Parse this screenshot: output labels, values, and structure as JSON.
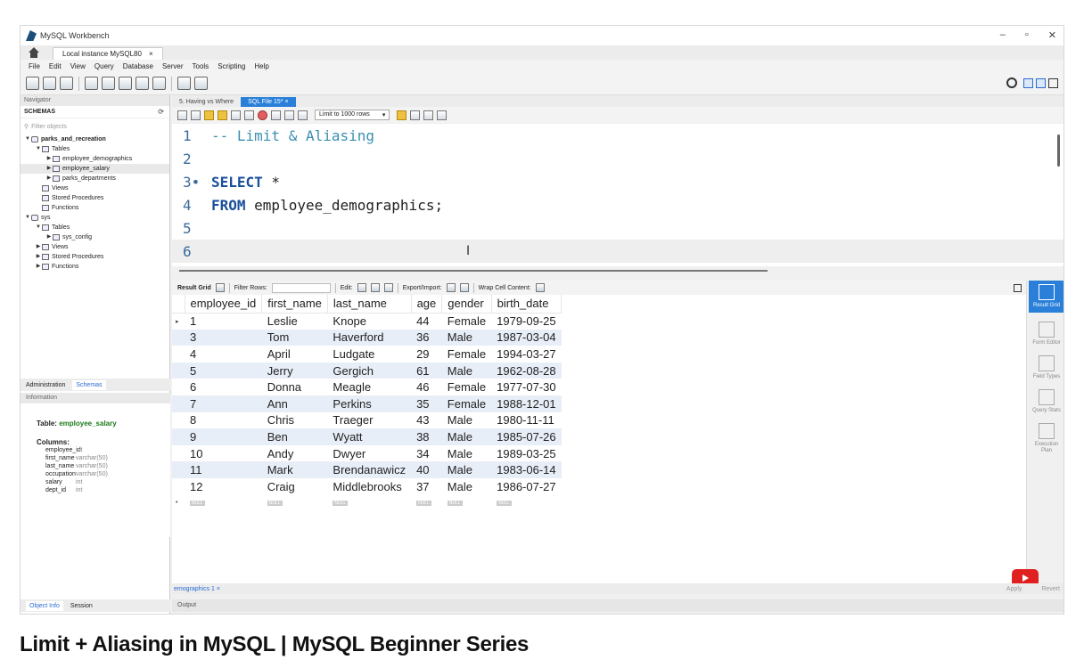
{
  "window": {
    "title": "MySQL Workbench",
    "connection_tab": "Local instance MySQL80",
    "close_glyph": "×"
  },
  "menu": [
    "File",
    "Edit",
    "View",
    "Query",
    "Database",
    "Server",
    "Tools",
    "Scripting",
    "Help"
  ],
  "navigator": {
    "header": "Navigator",
    "schemas_label": "SCHEMAS",
    "filter_placeholder": "Filter objects",
    "tree": [
      {
        "label": "parks_and_recreation",
        "level": 0,
        "arrow": "▼",
        "bold": true,
        "icon": "db"
      },
      {
        "label": "Tables",
        "level": 1,
        "arrow": "▼",
        "icon": "folder"
      },
      {
        "label": "employee_demographics",
        "level": 2,
        "arrow": "▶",
        "icon": "table"
      },
      {
        "label": "employee_salary",
        "level": 2,
        "arrow": "▶",
        "icon": "table",
        "selected": true
      },
      {
        "label": "parks_departments",
        "level": 2,
        "arrow": "▶",
        "icon": "table"
      },
      {
        "label": "Views",
        "level": 1,
        "arrow": "",
        "icon": "folder"
      },
      {
        "label": "Stored Procedures",
        "level": 1,
        "arrow": "",
        "icon": "folder"
      },
      {
        "label": "Functions",
        "level": 1,
        "arrow": "",
        "icon": "folder"
      },
      {
        "label": "sys",
        "level": 0,
        "arrow": "▼",
        "icon": "db"
      },
      {
        "label": "Tables",
        "level": 1,
        "arrow": "▼",
        "icon": "folder"
      },
      {
        "label": "sys_config",
        "level": 2,
        "arrow": "▶",
        "icon": "table"
      },
      {
        "label": "Views",
        "level": 1,
        "arrow": "▶",
        "icon": "folder"
      },
      {
        "label": "Stored Procedures",
        "level": 1,
        "arrow": "▶",
        "icon": "folder"
      },
      {
        "label": "Functions",
        "level": 1,
        "arrow": "▶",
        "icon": "folder"
      }
    ],
    "tabs": {
      "admin": "Administration",
      "schemas": "Schemas"
    }
  },
  "info": {
    "header": "Information",
    "table_prefix": "Table:",
    "table_name": "employee_salary",
    "columns_label": "Columns:",
    "columns": [
      {
        "name": "employee_id",
        "type": "int"
      },
      {
        "name": "first_name",
        "type": "varchar(50)"
      },
      {
        "name": "last_name",
        "type": "varchar(50)"
      },
      {
        "name": "occupation",
        "type": "varchar(50)"
      },
      {
        "name": "salary",
        "type": "int"
      },
      {
        "name": "dept_id",
        "type": "int"
      }
    ],
    "bottom_tabs": {
      "object_info": "Object Info",
      "session": "Session"
    }
  },
  "editor": {
    "tabs": [
      {
        "label": "5. Having vs Where",
        "active": false
      },
      {
        "label": "SQL File 15*",
        "active": true
      }
    ],
    "limit_label": "Limit to 1000 rows",
    "lines": [
      {
        "n": "1",
        "parts": [
          {
            "t": "-- Limit & Aliasing",
            "c": "cm"
          }
        ]
      },
      {
        "n": "2",
        "parts": []
      },
      {
        "n": "3•",
        "parts": [
          {
            "t": "SELECT",
            "c": "kw"
          },
          {
            "t": " *",
            "c": ""
          }
        ]
      },
      {
        "n": "4",
        "parts": [
          {
            "t": "FROM",
            "c": "kw"
          },
          {
            "t": " employee_demographics;",
            "c": ""
          }
        ]
      },
      {
        "n": "5",
        "parts": []
      },
      {
        "n": "6",
        "parts": [],
        "active": true
      }
    ]
  },
  "result_toolbar": {
    "result_grid": "Result Grid",
    "filter_rows": "Filter Rows:",
    "edit": "Edit:",
    "export_import": "Export/Import:",
    "wrap": "Wrap Cell Content:"
  },
  "results": {
    "columns": [
      "employee_id",
      "first_name",
      "last_name",
      "age",
      "gender",
      "birth_date"
    ],
    "rows": [
      [
        "1",
        "Leslie",
        "Knope",
        "44",
        "Female",
        "1979-09-25"
      ],
      [
        "3",
        "Tom",
        "Haverford",
        "36",
        "Male",
        "1987-03-04"
      ],
      [
        "4",
        "April",
        "Ludgate",
        "29",
        "Female",
        "1994-03-27"
      ],
      [
        "5",
        "Jerry",
        "Gergich",
        "61",
        "Male",
        "1962-08-28"
      ],
      [
        "6",
        "Donna",
        "Meagle",
        "46",
        "Female",
        "1977-07-30"
      ],
      [
        "7",
        "Ann",
        "Perkins",
        "35",
        "Female",
        "1988-12-01"
      ],
      [
        "8",
        "Chris",
        "Traeger",
        "43",
        "Male",
        "1980-11-11"
      ],
      [
        "9",
        "Ben",
        "Wyatt",
        "38",
        "Male",
        "1985-07-26"
      ],
      [
        "10",
        "Andy",
        "Dwyer",
        "34",
        "Male",
        "1989-03-25"
      ],
      [
        "11",
        "Mark",
        "Brendanawicz",
        "40",
        "Male",
        "1983-06-14"
      ],
      [
        "12",
        "Craig",
        "Middlebrooks",
        "37",
        "Male",
        "1986-07-27"
      ]
    ],
    "null_label": "NULL",
    "row_marker": "▸",
    "new_row_marker": "•"
  },
  "side_panel": [
    {
      "label": "Result Grid",
      "active": true
    },
    {
      "label": "Form Editor",
      "active": false
    },
    {
      "label": "Field Types",
      "active": false
    },
    {
      "label": "Query Stats",
      "active": false
    },
    {
      "label": "Execution Plan",
      "active": false
    }
  ],
  "bottom": {
    "result_tab": "emographics 1",
    "apply": "Apply",
    "revert": "Revert",
    "output": "Output"
  },
  "video_title": "Limit + Aliasing in MySQL | MySQL Beginner Series"
}
